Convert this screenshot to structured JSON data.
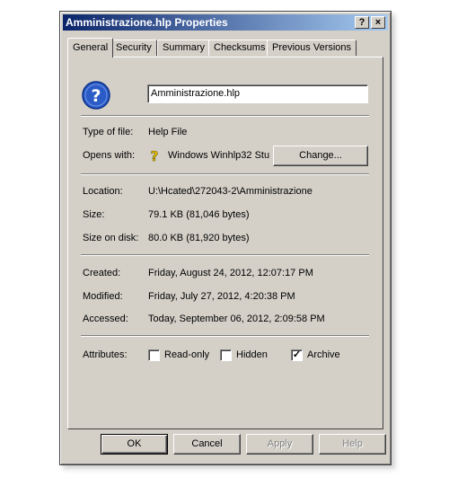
{
  "window": {
    "title": "Amministrazione.hlp Properties",
    "help_glyph": "?",
    "close_glyph": "×"
  },
  "tabs": [
    "General",
    "Security",
    "Summary",
    "Checksums",
    "Previous Versions"
  ],
  "general": {
    "file_name": "Amministrazione.hlp",
    "type_label": "Type of file:",
    "type_value": "Help File",
    "opens_label": "Opens with:",
    "opens_value": "Windows Winhlp32 Stu",
    "change_label": "Change...",
    "location_label": "Location:",
    "location_value": "U:\\Hcated\\272043-2\\Amministrazione",
    "size_label": "Size:",
    "size_value": "79.1 KB (81,046 bytes)",
    "size_on_disk_label": "Size on disk:",
    "size_on_disk_value": "80.0 KB (81,920 bytes)",
    "created_label": "Created:",
    "created_value": "Friday, August 24, 2012, 12:07:17 PM",
    "modified_label": "Modified:",
    "modified_value": "Friday, July 27, 2012, 4:20:38 PM",
    "accessed_label": "Accessed:",
    "accessed_value": "Today, September 06, 2012, 2:09:58 PM",
    "attributes_label": "Attributes:",
    "attributes": [
      {
        "label": "Read-only",
        "checked": false
      },
      {
        "label": "Hidden",
        "checked": false
      },
      {
        "label": "Archive",
        "checked": true
      }
    ]
  },
  "buttons": {
    "ok": "OK",
    "cancel": "Cancel",
    "apply": "Apply",
    "help": "Help"
  },
  "icons": {
    "file_icon": "help-file-icon",
    "opens_icon": "help-question-icon"
  },
  "colors": {
    "title_start": "#0a246a",
    "title_end": "#a6caf0",
    "face": "#d4d0c8",
    "icon_blue": "#2a5bc7"
  }
}
